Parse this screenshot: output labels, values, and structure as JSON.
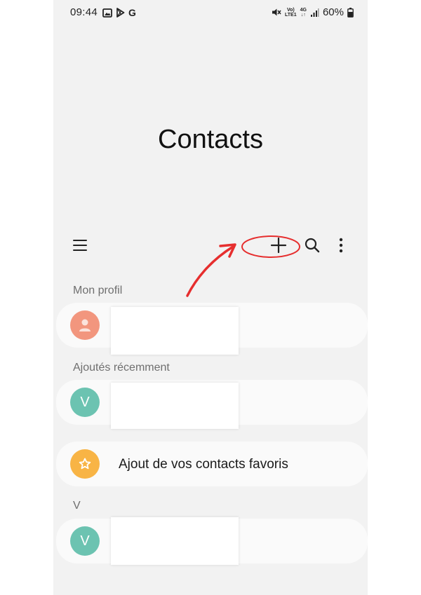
{
  "status_bar": {
    "time": "09:44",
    "battery": "60%",
    "network_top": "Vo)",
    "network_bottom": "LTE1",
    "gen": "4G",
    "gen_bottom": "↓↑"
  },
  "app": {
    "title": "Contacts"
  },
  "toolbar": {
    "menu_icon": "menu-icon",
    "add_icon": "plus-icon",
    "search_icon": "search-icon",
    "more_icon": "more-vertical-icon"
  },
  "sections": {
    "profile_label": "Mon profil",
    "recent_label": "Ajoutés récemment",
    "v_label": "V"
  },
  "contacts": {
    "recent_avatar_letter": "V",
    "v_avatar_letter": "V"
  },
  "favorites": {
    "label": "Ajout de vos contacts favoris"
  },
  "colors": {
    "background": "#f2f2f2",
    "profile_avatar": "#f2967e",
    "contact_avatar": "#6cc3b1",
    "favorite_avatar": "#f8b445",
    "annotation_red": "#e62e2e"
  }
}
